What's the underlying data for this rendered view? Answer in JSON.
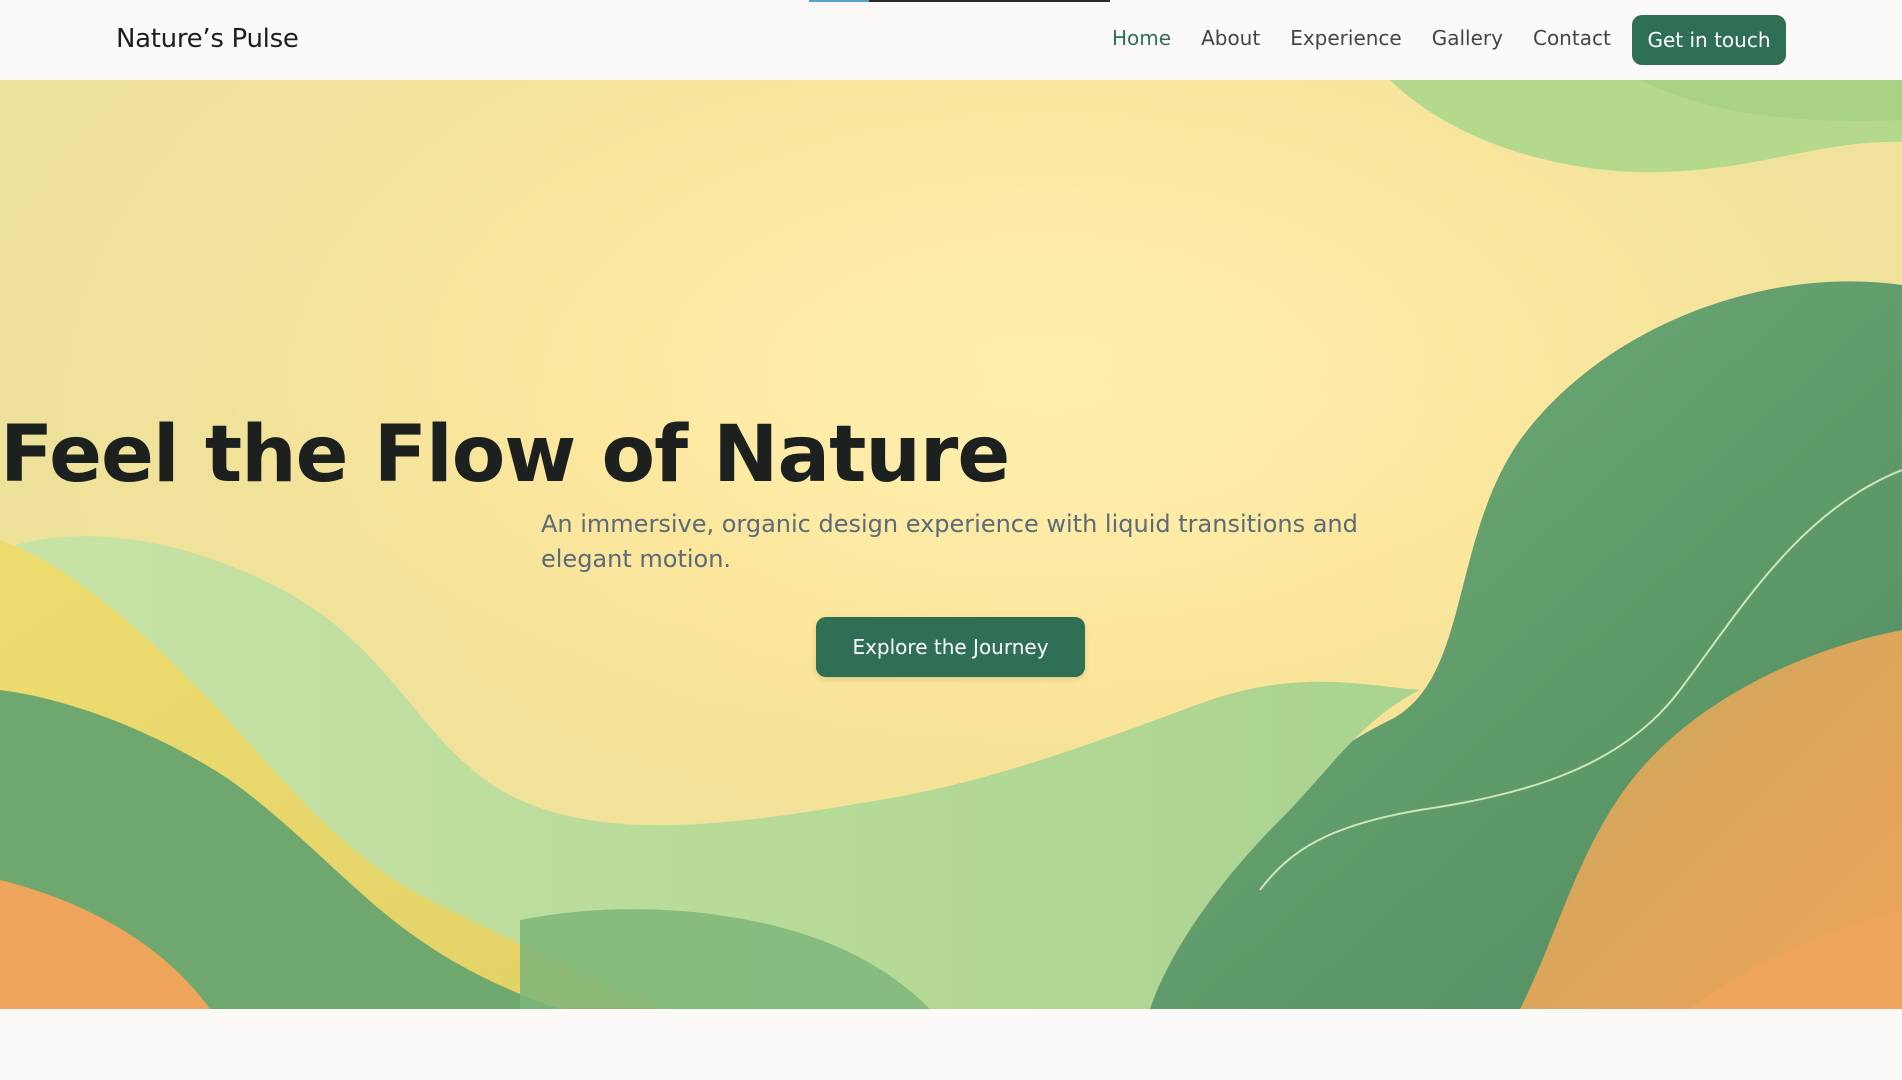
{
  "site": {
    "logo": "Nature’s Pulse",
    "scroll_progress": 0.2
  },
  "nav": {
    "items": [
      {
        "label": "Home",
        "active": true
      },
      {
        "label": "About",
        "active": false
      },
      {
        "label": "Experience",
        "active": false
      },
      {
        "label": "Gallery",
        "active": false
      },
      {
        "label": "Contact",
        "active": false
      }
    ],
    "cta_label": "Get in touch"
  },
  "hero": {
    "title": "Feel the Flow of Nature",
    "subtitle": "An immersive, organic design experience with liquid transitions and elegant motion.",
    "cta_label": "Explore the Journey"
  },
  "colors": {
    "brand_green": "#2f6f53",
    "active_nav": "#2f7157",
    "hero_yellow": "#fbe293",
    "leaf_green": "#67a06c",
    "light_green": "#b9dd98",
    "orange": "#eea45a"
  }
}
